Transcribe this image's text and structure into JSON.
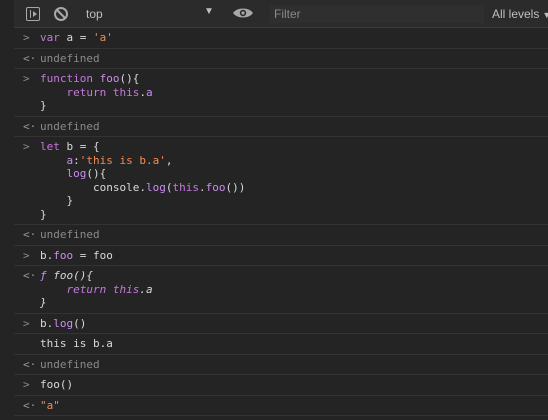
{
  "toolbar": {
    "context": "top",
    "filter_placeholder": "Filter",
    "levels": "All levels"
  },
  "entries": [
    {
      "in": "var a = 'a'",
      "out": "undefined"
    },
    {
      "in_lines": [
        "function foo(){",
        "    return this.a",
        "}"
      ],
      "out": "undefined"
    },
    {
      "in_lines": [
        "let b = {",
        "    a:'this is b.a',",
        "    log(){",
        "        console.log(this.foo())",
        "    }",
        "}"
      ],
      "out": "undefined"
    },
    {
      "in": "b.foo = foo",
      "out_lines": [
        "ƒ foo(){",
        "    return this.a",
        "}"
      ]
    },
    {
      "in": "b.log()",
      "log": "this is b.a",
      "out": "undefined"
    },
    {
      "in": "foo()",
      "out": "\"a\""
    }
  ],
  "icons": {
    "sidebar": "sidebar-toggle-icon",
    "clear": "clear-console-icon",
    "eye": "eye-icon",
    "input": "chevron-right-icon",
    "output": "return-arrow-icon"
  }
}
